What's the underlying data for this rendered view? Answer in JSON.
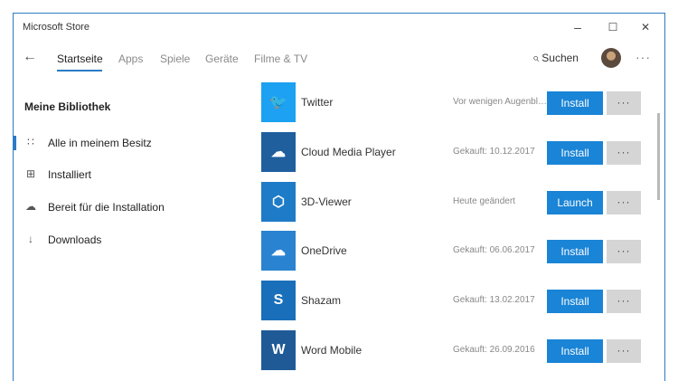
{
  "window": {
    "title": "Microsoft Store",
    "minimize": "–",
    "maximize": "☐",
    "close": "✕"
  },
  "nav": {
    "back": "←",
    "tabs": [
      {
        "label": "Startseite",
        "active": true
      },
      {
        "label": "Apps",
        "active": false
      },
      {
        "label": "Spiele",
        "active": false
      },
      {
        "label": "Geräte",
        "active": false
      },
      {
        "label": "Filme & TV",
        "active": false
      }
    ],
    "search_icon": "⌕",
    "search_label": "Suchen",
    "more": "···"
  },
  "sidebar": {
    "title": "Meine Bibliothek",
    "items": [
      {
        "icon": "∷",
        "icon_name": "grid-icon",
        "label": "Alle in meinem Besitz",
        "active": true
      },
      {
        "icon": "⊞",
        "icon_name": "installed-icon",
        "label": "Installiert",
        "active": false
      },
      {
        "icon": "☁",
        "icon_name": "cloud-download-icon",
        "label": "Bereit für die Installation",
        "active": false
      },
      {
        "icon": "↓",
        "icon_name": "download-icon",
        "label": "Downloads",
        "active": false
      }
    ]
  },
  "apps": [
    {
      "name": "Twitter",
      "status": "Vor wenigen Augenblicken",
      "button": "Install",
      "more": "···",
      "tile_color": "#1da1f2",
      "icon": "🐦",
      "icon_name": "twitter-bird-icon"
    },
    {
      "name": "Cloud Media Player",
      "status": "Gekauft: 10.12.2017",
      "button": "Install",
      "more": "···",
      "tile_color": "#1f5f9e",
      "icon": "☁",
      "icon_name": "cloud-play-icon"
    },
    {
      "name": "3D-Viewer",
      "status": "Heute geändert",
      "button": "Launch",
      "more": "···",
      "tile_color": "#1e7bc7",
      "icon": "⬡",
      "icon_name": "cube-icon"
    },
    {
      "name": "OneDrive",
      "status": "Gekauft: 06.06.2017",
      "button": "Install",
      "more": "···",
      "tile_color": "#2a83d0",
      "icon": "☁",
      "icon_name": "onedrive-cloud-icon"
    },
    {
      "name": "Shazam",
      "status": "Gekauft: 13.02.2017",
      "button": "Install",
      "more": "···",
      "tile_color": "#1a6fba",
      "icon": "S",
      "icon_name": "shazam-icon"
    },
    {
      "name": "Word Mobile",
      "status": "Gekauft: 26.09.2016",
      "button": "Install",
      "more": "···",
      "tile_color": "#1f5a97",
      "icon": "W",
      "icon_name": "word-icon"
    }
  ],
  "colors": {
    "accent": "#1a84d6",
    "frame_border": "#2b7bc5",
    "more_button": "#d5d5d5"
  }
}
